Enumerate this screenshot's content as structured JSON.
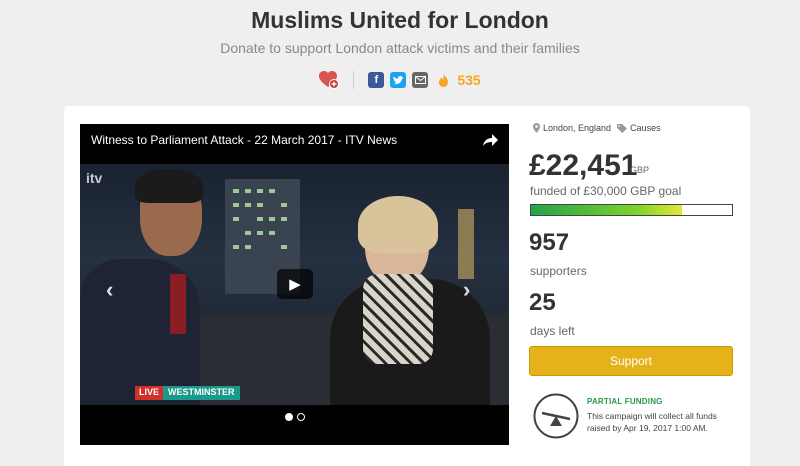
{
  "header": {
    "title": "Muslims United for London",
    "subtitle": "Donate to support London attack victims and their families",
    "icons": [
      "heart-plus-icon",
      "facebook-icon",
      "twitter-icon",
      "email-icon",
      "fire-icon"
    ],
    "fire_count": "535"
  },
  "video": {
    "title": "Witness to Parliament Attack - 22 March 2017 - ITV News",
    "channel_logo": "itv",
    "live_label": "LIVE",
    "location_label": "WESTMINSTER",
    "slide_count": 2,
    "active_slide": 1
  },
  "campaign": {
    "location": "London, England",
    "category": "Causes",
    "amount_raised": "£22,451",
    "currency": "GBP",
    "goal_text": "funded of £30,000 GBP goal",
    "funded_fraction": 0.75,
    "supporters_count": "957",
    "supporters_label": "supporters",
    "days_left": "25",
    "days_label": "days left",
    "support_button": "Support",
    "partial_funding_title": "PARTIAL FUNDING",
    "partial_funding_text": "This campaign will collect all funds raised by Apr 19, 2017 1:00 AM.",
    "colors": {
      "accent": "#e6b21a",
      "progress_start": "#22a34a",
      "partial_green": "#2a9a4a"
    }
  }
}
